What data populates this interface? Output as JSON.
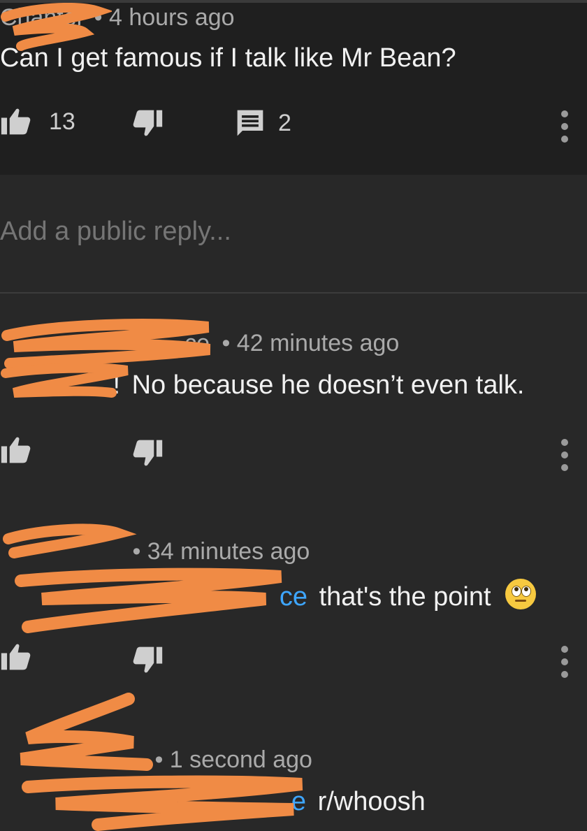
{
  "parent_comment": {
    "author": "Chantel",
    "timestamp": "• 4 hours ago",
    "text": "Can I get famous if I talk like Mr Bean?",
    "like_count": "13",
    "reply_count": "2"
  },
  "reply_box": {
    "placeholder": "Add a public reply..."
  },
  "replies": [
    {
      "author_visible": "ce",
      "timestamp": "• 42 minutes ago",
      "mention_prefix": "!",
      "text": "No because he doesn’t even talk."
    },
    {
      "timestamp": "• 34 minutes ago",
      "mention_visible": "ce",
      "text": "that's the point",
      "emoji": "face-with-rolling-eyes"
    },
    {
      "timestamp": "• 1 second ago",
      "mention_visible": "e",
      "text": "r/whoosh"
    }
  ],
  "icons": {
    "like": "thumbs-up-icon",
    "dislike": "thumbs-down-icon",
    "reply": "comment-icon",
    "more": "more-vert-icon"
  },
  "colors": {
    "background": "#282828",
    "parent_background": "#1f1f1f",
    "mention": "#3ea6ff",
    "redaction": "#f08b45"
  }
}
